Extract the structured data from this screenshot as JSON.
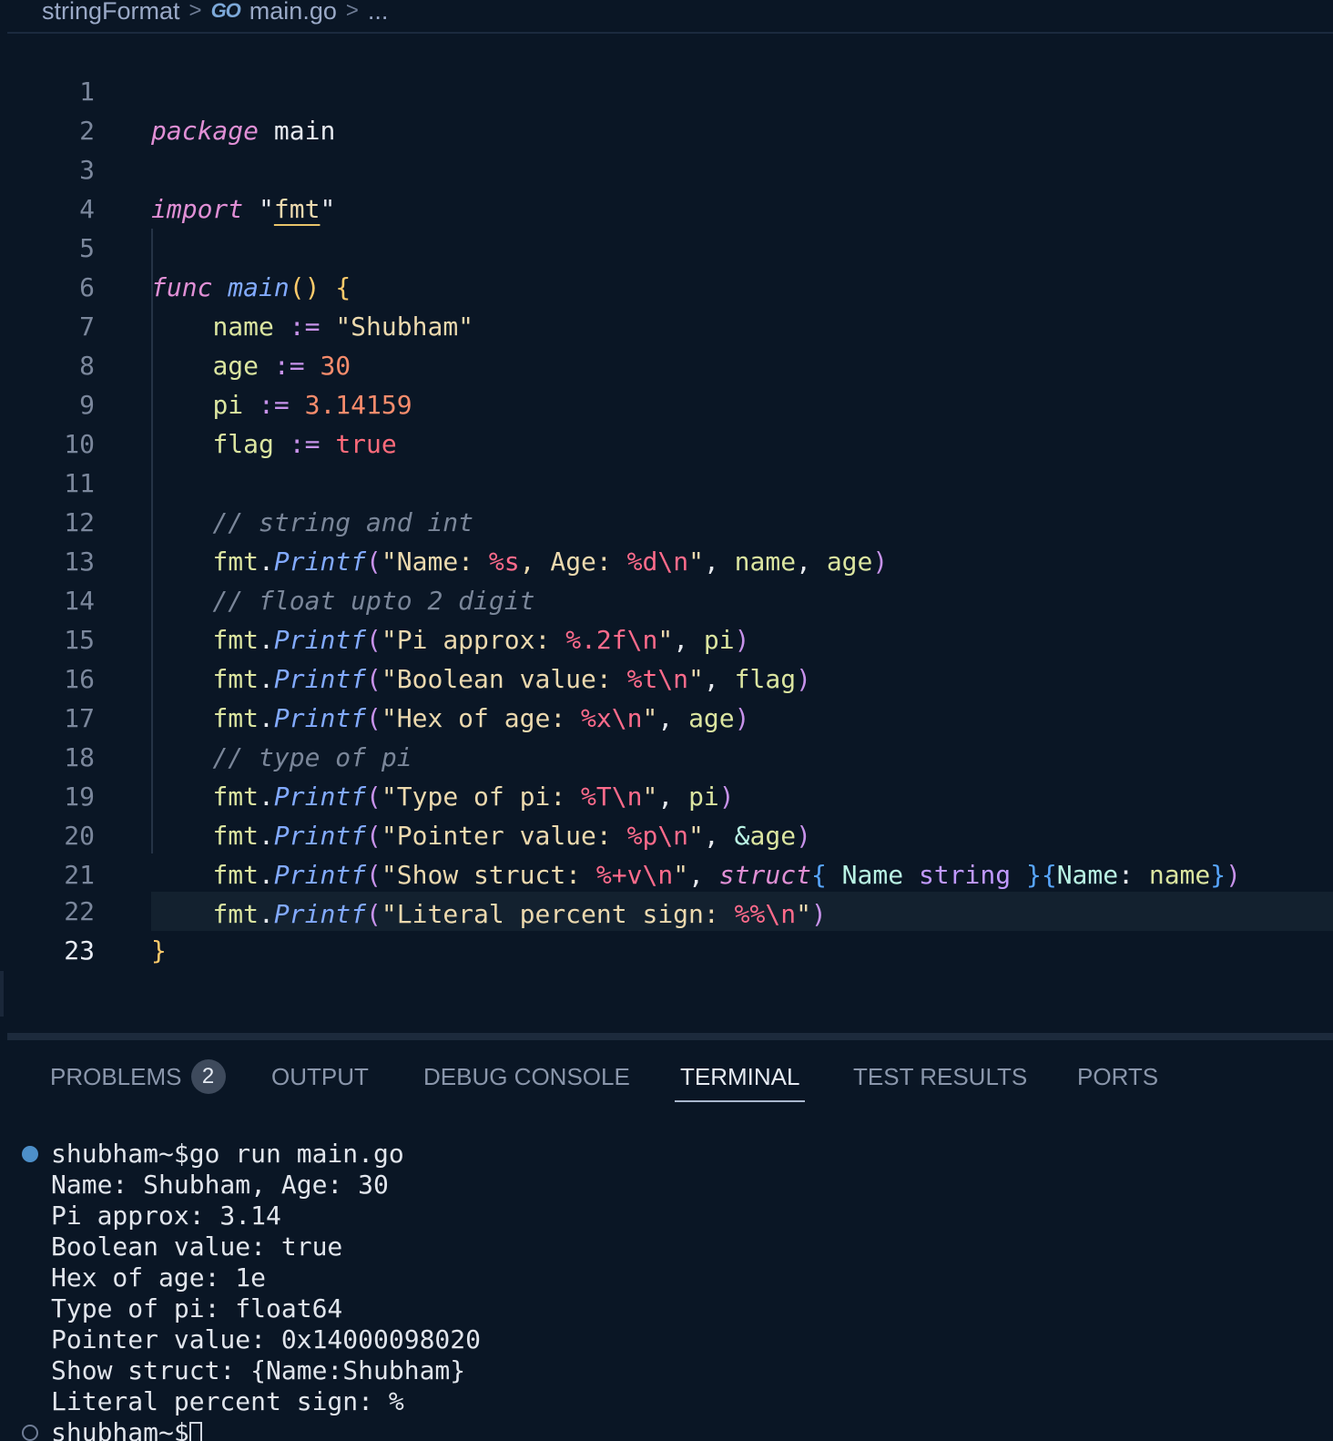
{
  "breadcrumb": {
    "folder": "stringFormat",
    "go_icon": "GO",
    "file": "main.go",
    "more": "..."
  },
  "editor": {
    "current_line": 23,
    "line_numbers": [
      "1",
      "2",
      "3",
      "4",
      "5",
      "6",
      "7",
      "8",
      "9",
      "10",
      "11",
      "12",
      "13",
      "14",
      "15",
      "16",
      "17",
      "18",
      "19",
      "20",
      "21",
      "22",
      "23"
    ],
    "code": {
      "l1": {
        "kw": "package",
        "name": "main"
      },
      "l3": {
        "kw": "import",
        "q1": "\"",
        "pkg": "fmt",
        "q2": "\""
      },
      "l5": {
        "kw": "func",
        "fn": "main",
        "parens": "()",
        "brace": "{"
      },
      "l6": {
        "name": "name",
        "op": ":=",
        "str": "\"Shubham\""
      },
      "l7": {
        "name": "age",
        "op": ":=",
        "num": "30"
      },
      "l8": {
        "name": "pi",
        "op": ":=",
        "num": "3.14159"
      },
      "l9": {
        "name": "flag",
        "op": ":=",
        "val": "true"
      },
      "l11": {
        "comment": "// string and int"
      },
      "l12": {
        "pkg": "fmt",
        "dot": ".",
        "fn": "Printf",
        "lp": "(",
        "s1": "\"Name: ",
        "v1": "%s",
        "s2": ", Age: ",
        "v2": "%d\\n",
        "s3": "\"",
        "comma1": ", ",
        "a1": "name",
        "comma2": ", ",
        "a2": "age",
        "rp": ")"
      },
      "l13": {
        "comment": "// float upto 2 digit"
      },
      "l14": {
        "pkg": "fmt",
        "dot": ".",
        "fn": "Printf",
        "lp": "(",
        "s1": "\"Pi approx: ",
        "v1": "%.2f\\n",
        "s2": "\"",
        "comma1": ", ",
        "a1": "pi",
        "rp": ")"
      },
      "l15": {
        "pkg": "fmt",
        "dot": ".",
        "fn": "Printf",
        "lp": "(",
        "s1": "\"Boolean value: ",
        "v1": "%t\\n",
        "s2": "\"",
        "comma1": ", ",
        "a1": "flag",
        "rp": ")"
      },
      "l16": {
        "pkg": "fmt",
        "dot": ".",
        "fn": "Printf",
        "lp": "(",
        "s1": "\"Hex of age: ",
        "v1": "%x\\n",
        "s2": "\"",
        "comma1": ", ",
        "a1": "age",
        "rp": ")"
      },
      "l17": {
        "comment": "// type of pi"
      },
      "l18": {
        "pkg": "fmt",
        "dot": ".",
        "fn": "Printf",
        "lp": "(",
        "s1": "\"Type of pi: ",
        "v1": "%T\\n",
        "s2": "\"",
        "comma1": ", ",
        "a1": "pi",
        "rp": ")"
      },
      "l19": {
        "pkg": "fmt",
        "dot": ".",
        "fn": "Printf",
        "lp": "(",
        "s1": "\"Pointer value: ",
        "v1": "%p\\n",
        "s2": "\"",
        "comma1": ", ",
        "amp": "&",
        "a1": "age",
        "rp": ")"
      },
      "l20": {
        "pkg": "fmt",
        "dot": ".",
        "fn": "Printf",
        "lp": "(",
        "s1": "\"Show struct: ",
        "v1": "%+v\\n",
        "s2": "\"",
        "comma1": ", ",
        "kw": "struct",
        "lb": "{",
        "field": " Name ",
        "type": "string",
        "rb": " }",
        "lb2": "{",
        "field2": "Name",
        "colon": ": ",
        "a1": "name",
        "rb2": "}",
        "rp": ")"
      },
      "l21": {
        "pkg": "fmt",
        "dot": ".",
        "fn": "Printf",
        "lp": "(",
        "s1": "\"Literal percent sign: ",
        "v1": "%%\\n",
        "s2": "\"",
        "rp": ")"
      },
      "l22": {
        "brace": "}"
      }
    }
  },
  "panel": {
    "tabs": {
      "problems": "PROBLEMS",
      "problems_count": "2",
      "output": "OUTPUT",
      "debug_console": "DEBUG CONSOLE",
      "terminal": "TERMINAL",
      "test_results": "TEST RESULTS",
      "ports": "PORTS"
    },
    "active_tab": "TERMINAL"
  },
  "terminal": {
    "command": "shubham~$go run main.go",
    "output": [
      "Name: Shubham, Age: 30",
      "Pi approx: 3.14",
      "Boolean value: true",
      "Hex of age: 1e",
      "Type of pi: float64",
      "Pointer value: 0x14000098020",
      "Show struct: {Name:Shubham}",
      "Literal percent sign: %"
    ],
    "prompt": "shubham~$"
  },
  "colors": {
    "background": "#0a1625",
    "keyword": "#e08fd5",
    "function": "#82aaff",
    "string": "#ecd9ae",
    "identifier": "#dbe5a0",
    "number": "#f78c6c",
    "format_verb": "#ff6b8b",
    "comment": "#7a8699",
    "terminal_dot": "#4d8fc9"
  }
}
